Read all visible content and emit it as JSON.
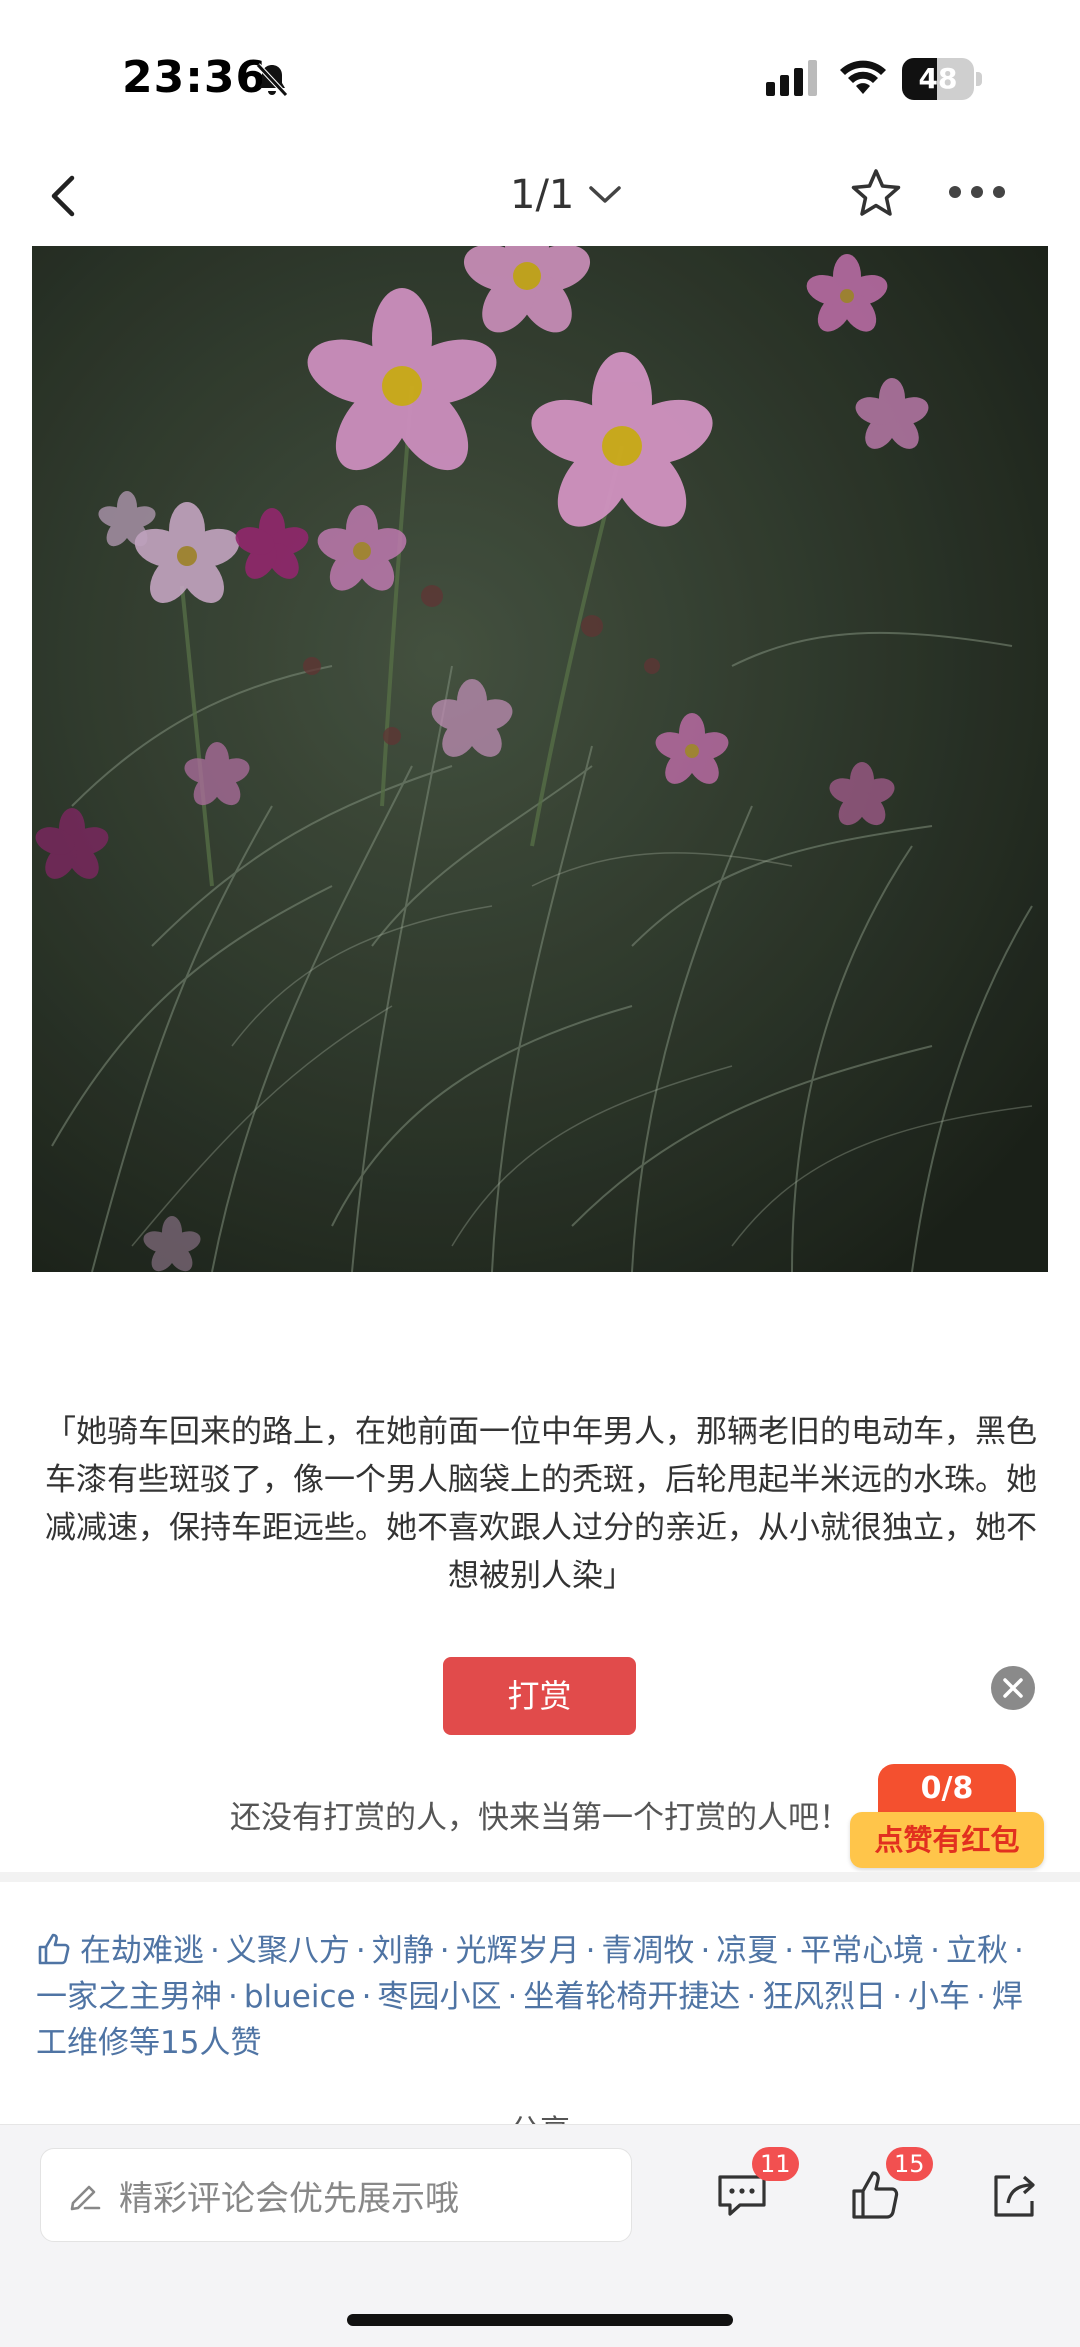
{
  "status_bar": {
    "time": "23:36",
    "battery": "48",
    "battery_level": 0.48,
    "icons": [
      "bell-slash-icon",
      "cellular-signal-icon",
      "wifi-icon",
      "battery-icon"
    ]
  },
  "nav": {
    "pager": "1/1",
    "icons": [
      "back-arrow-icon",
      "chevron-down-icon",
      "star-icon",
      "more-icon"
    ]
  },
  "post": {
    "quote": "「她骑车回来的路上，在她前面一位中年男人，那辆老旧的电动车，黑色车漆有些斑驳了，像一个男人脑袋上的秃斑，后轮甩起半米远的水珠。她减减速，保持车距远些。她不喜欢跟人过分的亲近，从小就很独立，她不想被别人染」"
  },
  "reward": {
    "button_label": "打赏",
    "empty_text": "还没有打赏的人，快来当第一个打赏的人吧！",
    "red_packet_count": "0/8",
    "red_packet_label": "点赞有红包"
  },
  "likes": {
    "names": [
      "在劫难逃",
      "义聚八方",
      "刘静",
      "光辉岁月",
      "青凋牧",
      "凉夏",
      "平常心境",
      "立秋",
      "一家之主男神",
      "blueice",
      "枣园小区",
      "坐着轮椅开捷达",
      "狂风烈日",
      "小车",
      "焊工维修"
    ],
    "separator": "·",
    "suffix": "等15人赞"
  },
  "section_peek": "分享",
  "bottom_bar": {
    "comment_placeholder": "精彩评论会优先展示哦",
    "comment_count": "11",
    "like_count": "15"
  },
  "colors": {
    "accent_red": "#e14b4b",
    "link_blue": "#4f74a4",
    "badge_red": "#f25050",
    "red_packet_yellow": "#ffc54a"
  }
}
